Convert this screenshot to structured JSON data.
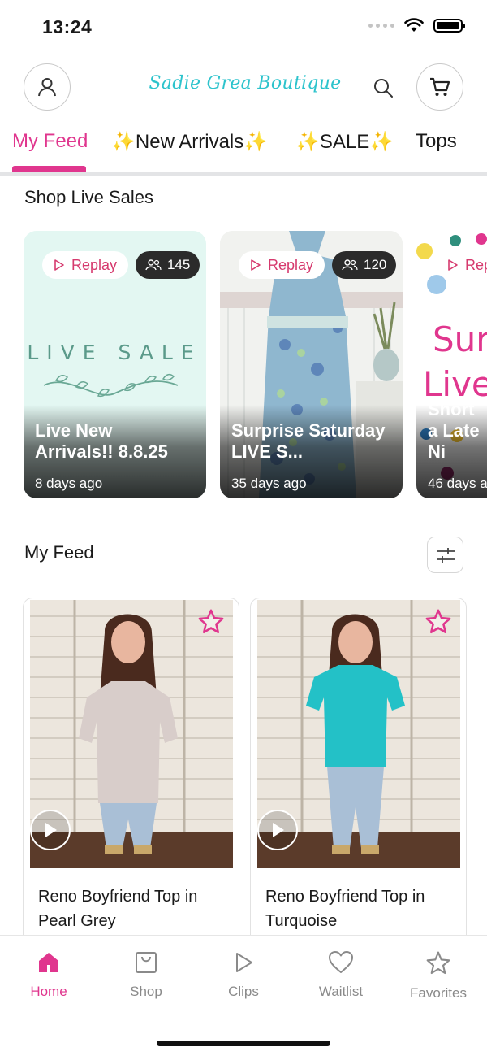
{
  "status": {
    "time": "13:24"
  },
  "header": {
    "brand": "Sadie Grea Boutique"
  },
  "tabs": [
    {
      "label": "My Feed",
      "active": true
    },
    {
      "label": "New Arrivals",
      "sparkles": true
    },
    {
      "label": "SALE",
      "sparkles": true
    },
    {
      "label": "Tops"
    }
  ],
  "live_sales": {
    "heading": "Shop Live Sales",
    "cards": [
      {
        "replay": "Replay",
        "viewers": "145",
        "title": "Live New Arrivals!! 8.8.25",
        "ago": "8 days ago",
        "art_text": "LIVE SALE"
      },
      {
        "replay": "Replay",
        "viewers": "120",
        "title": "Surprise Saturday LIVE S...",
        "ago": "35 days ago"
      },
      {
        "replay": "Rep",
        "title": "Short a Late Ni",
        "ago": "46 days a",
        "art_text_1": "Sur",
        "art_text_2": "Live"
      }
    ]
  },
  "feed": {
    "heading": "My Feed",
    "products": [
      {
        "name": "Reno Boyfriend Top in Pearl Grey",
        "shirt_color": "#d8cdca"
      },
      {
        "name": "Reno Boyfriend Top in Turquoise",
        "shirt_color": "#23c1c7"
      }
    ]
  },
  "bottom_nav": [
    {
      "label": "Home",
      "icon": "home-icon",
      "active": true
    },
    {
      "label": "Shop",
      "icon": "shopping-bag-icon"
    },
    {
      "label": "Clips",
      "icon": "play-icon"
    },
    {
      "label": "Waitlist",
      "icon": "heart-icon"
    },
    {
      "label": "Favorites",
      "icon": "star-icon"
    }
  ],
  "colors": {
    "accent": "#e0368e",
    "brand": "#2cc3cc",
    "live_sale_bg": "#e3f7f2"
  }
}
